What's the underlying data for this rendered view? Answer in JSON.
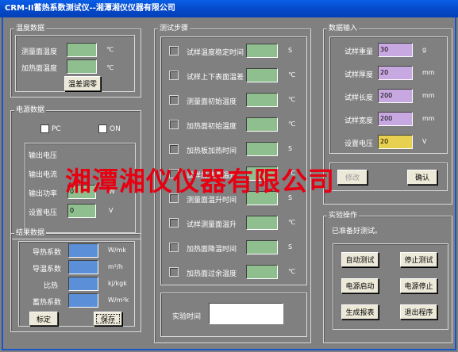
{
  "window": {
    "title": "CRM-II蓄热系数测试仪--湘潭湘仪仪器有限公司"
  },
  "colors": {
    "green_field": "#8fbf8f",
    "blue_field": "#5b8fd8",
    "violet_field": "#c8a8e0",
    "yellow_field": "#e8d050",
    "watermark": "#e60012"
  },
  "temp": {
    "title": "温度数据",
    "measure_label": "测量面温度",
    "measure_unit": "℃",
    "heat_label": "加热面温度",
    "heat_unit": "℃",
    "adjust_button": "温差调零"
  },
  "power": {
    "title": "电源数据",
    "pc_label": "PC",
    "on_label": "ON",
    "out_voltage_label": "输出电压",
    "out_current_label": "输出电流",
    "out_power_label": "输出功率",
    "out_power_value": "0",
    "out_power_unit": "W",
    "set_voltage_label": "设置电压",
    "set_voltage_value": "0",
    "set_voltage_unit": "V"
  },
  "result": {
    "title": "结果数据",
    "rows": [
      {
        "label": "导热系数",
        "unit": "W/mk"
      },
      {
        "label": "导温系数",
        "unit": "m²/h"
      },
      {
        "label": "比热",
        "unit": "kj/kgk"
      },
      {
        "label": "蓄热系数",
        "unit": "W/m²k"
      }
    ],
    "calibrate_button": "标定",
    "save_button": "保存"
  },
  "steps": {
    "title": "测试步骤",
    "items": [
      {
        "label": "试样温度稳定时间",
        "unit": "S"
      },
      {
        "label": "试样上下表面温差",
        "unit": "℃"
      },
      {
        "label": "测量面初始温度",
        "unit": "℃"
      },
      {
        "label": "加热面初始温度",
        "unit": "℃"
      },
      {
        "label": "加热板加热时间",
        "unit": "S"
      },
      {
        "label": "试样加热面温升",
        "unit": "℃"
      },
      {
        "label": "测量面温升时间",
        "unit": "S"
      },
      {
        "label": "试样测量面温升",
        "unit": "℃"
      },
      {
        "label": "加热面降温时间",
        "unit": "S"
      },
      {
        "label": "加热面过余温度",
        "unit": "℃"
      }
    ],
    "time_label": "实验时间"
  },
  "input": {
    "title": "数据输入",
    "weight_label": "试样重量",
    "weight_value": "30",
    "weight_unit": "g",
    "thickness_label": "试样厚度",
    "thickness_value": "20",
    "thickness_unit": "mm",
    "length_label": "试样长度",
    "length_value": "200",
    "length_unit": "mm",
    "width_label": "试样宽度",
    "width_value": "200",
    "width_unit": "mm",
    "voltage_label": "设置电压",
    "voltage_value": "20",
    "voltage_unit": "V",
    "modify_button": "修改",
    "confirm_button": "确认"
  },
  "ops": {
    "title": "实验操作",
    "status": "已准备好测试。",
    "buttons": [
      "自动测试",
      "停止测试",
      "电源启动",
      "电源停止",
      "生成报表",
      "退出程序"
    ]
  },
  "watermark": {
    "text": "湘潭湘仪仪器有限公司"
  }
}
